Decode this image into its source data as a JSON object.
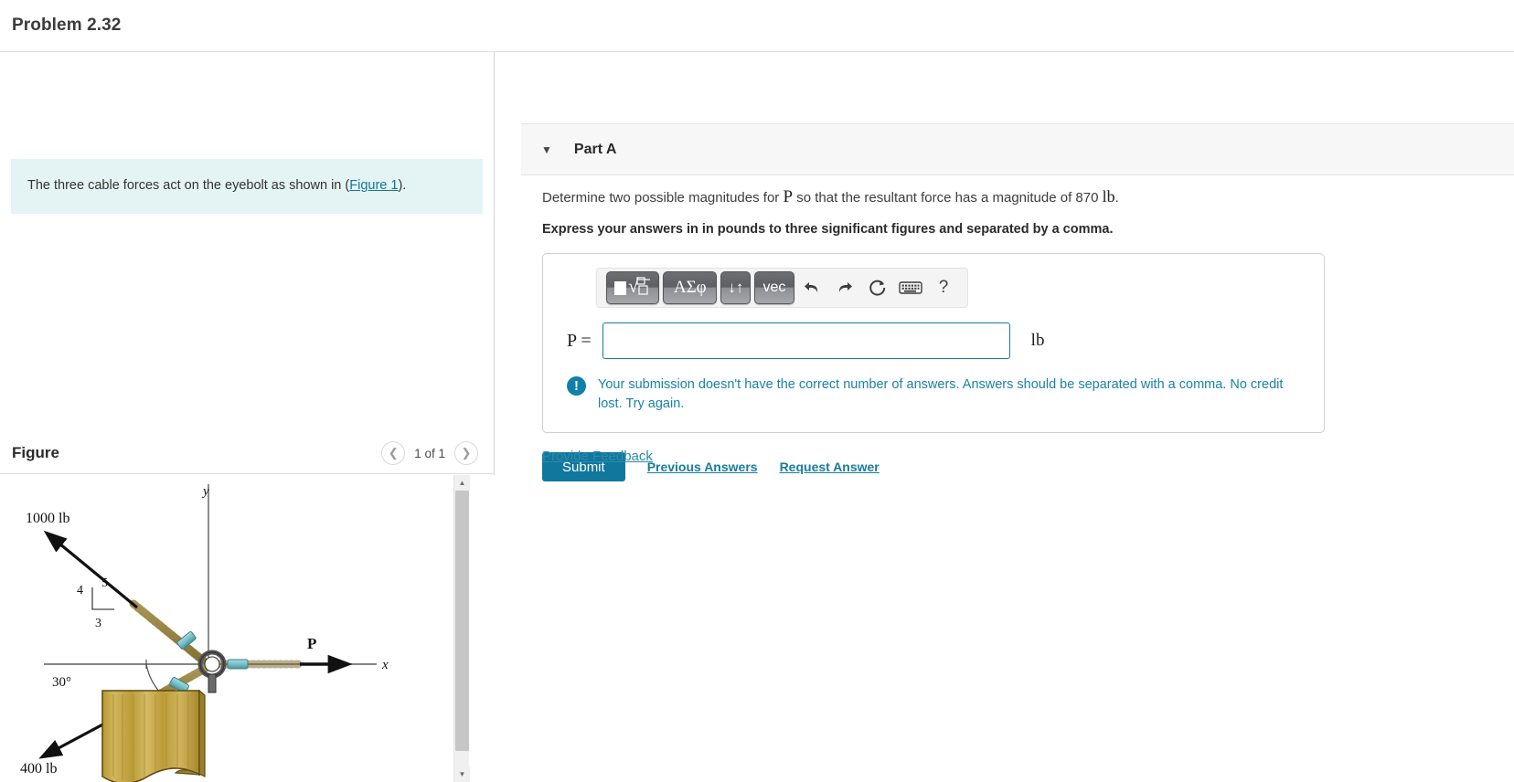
{
  "header": {
    "problem_title": "Problem 2.32"
  },
  "left": {
    "statement_prefix": "The three cable forces act on the eyebolt as shown in (",
    "statement_link": "Figure 1",
    "statement_suffix": ").",
    "figure_title": "Figure",
    "figure_count": "1 of 1",
    "prev_icon": "chevron-left-icon",
    "next_icon": "chevron-right-icon",
    "scroll_up_icon": "triangle-up-icon",
    "scroll_down_icon": "triangle-down-icon"
  },
  "figure": {
    "axis_y_label": "y",
    "axis_x_label": "x",
    "force_1000_label": "1000 lb",
    "force_400_label": "400 lb",
    "force_p_label": "P",
    "triangle_vertical": "4",
    "triangle_hypotenuse": "5",
    "triangle_horizontal": "3",
    "angle_label": "30°",
    "colors": {
      "wood": "#c8a84b",
      "wood_dark": "#a98b33",
      "rope": "#b8a35c",
      "clip": "#79c3c9",
      "ring": "#595959",
      "arrow": "#141414"
    }
  },
  "part_a": {
    "caret_icon": "caret-down-icon",
    "label": "Part A",
    "prompt_before_var": "Determine two possible magnitudes for ",
    "prompt_var": "P",
    "prompt_after_var": " so that the resultant force has a magnitude of 870 ",
    "prompt_unit": "lb",
    "prompt_end": ".",
    "instruction": "Express your answers in in pounds to three significant figures and separated by a comma."
  },
  "toolbar": {
    "template_button": "template-math-icon",
    "greek_button": "ΑΣφ",
    "arrows_button": "↓↑",
    "vec_button": "vec",
    "undo_icon": "undo-arrow-icon",
    "redo_icon": "redo-arrow-icon",
    "reset_icon": "reset-circle-icon",
    "keyboard_icon": "keyboard-icon",
    "help_icon": "question-mark-icon",
    "help_label": "?"
  },
  "answer": {
    "variable_label": "P =",
    "value": "",
    "placeholder": "",
    "unit": "lb",
    "border_color": "#1a7b9c"
  },
  "feedback": {
    "icon": "exclamation-circle-icon",
    "line1": "Your submission doesn't have the correct number of answers. Answers should be separated with a comma.",
    "line2": "No credit lost. Try again.",
    "color": "#1a82a8"
  },
  "actions": {
    "submit_label": "Submit",
    "previous_answers_label": "Previous Answers",
    "request_answer_label": "Request Answer",
    "submit_color": "#10779d"
  },
  "footer": {
    "provide_feedback_label": "Provide Feedback"
  }
}
